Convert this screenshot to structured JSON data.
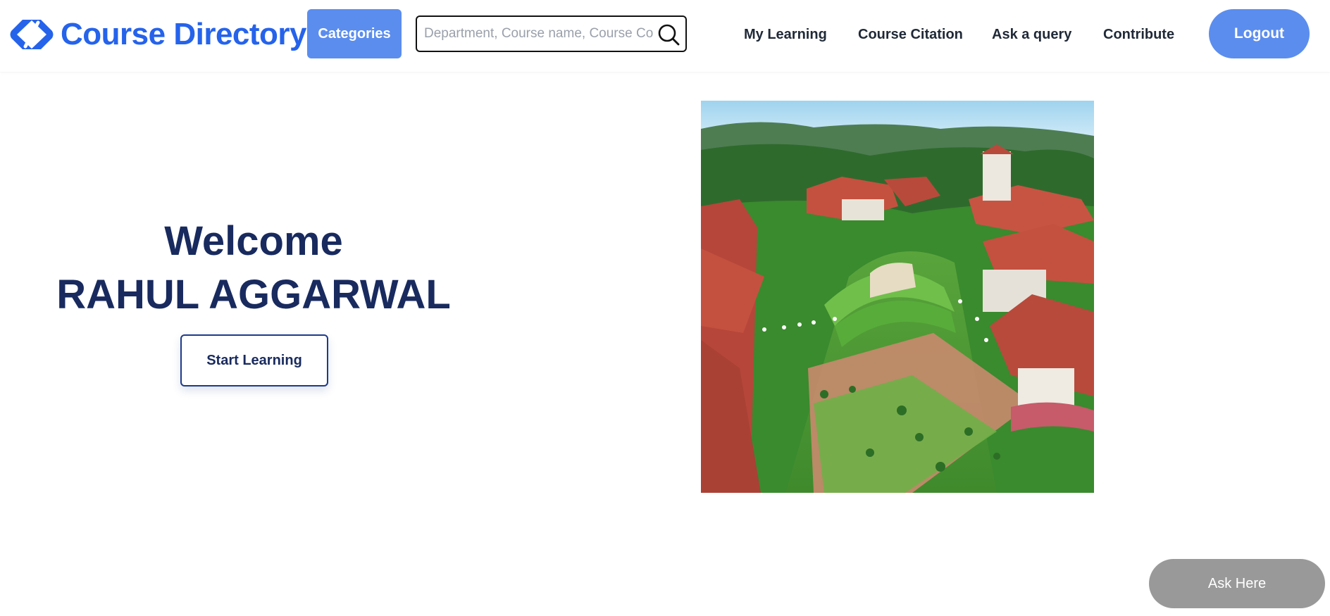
{
  "header": {
    "brand": {
      "title": "Course Directory",
      "logo_icon": "chevron-logo-icon",
      "color": "#2563eb"
    },
    "categories_label": "Categories",
    "search": {
      "placeholder": "Department, Course name, Course Code",
      "value": "",
      "icon": "search-icon"
    },
    "nav_links": [
      "My Learning",
      "Course Citation",
      "Ask a query",
      "Contribute"
    ],
    "logout_label": "Logout",
    "button_color": "#5b8dee"
  },
  "hero": {
    "greeting": "Welcome",
    "user_name": "RAHUL AGGARWAL",
    "cta_label": "Start Learning",
    "image_icon": "campus-photo"
  },
  "chat": {
    "ask_label": "Ask Here"
  }
}
